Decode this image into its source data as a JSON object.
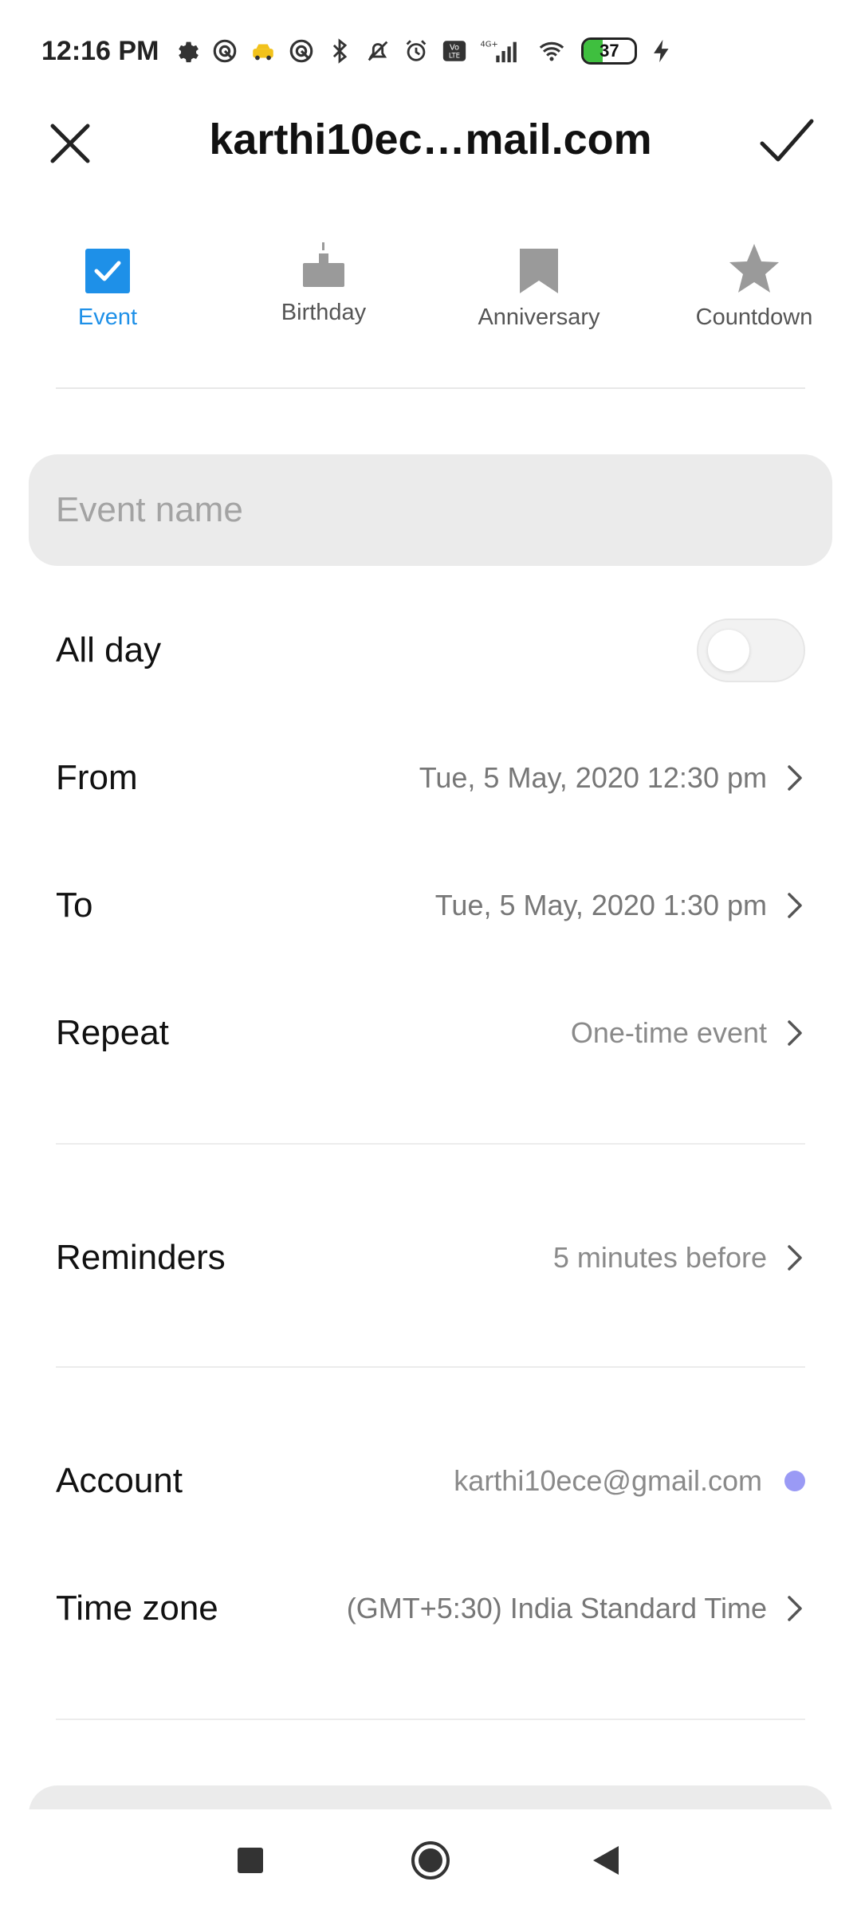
{
  "status_bar": {
    "time": "12:16 PM",
    "network": "4G+",
    "volte": "Vo LTE",
    "battery": "37",
    "battery_level": 0.37
  },
  "header": {
    "title": "karthi10ec…mail.com"
  },
  "tabs": [
    {
      "label": "Event",
      "icon": "checkbox-icon",
      "active": true
    },
    {
      "label": "Birthday",
      "icon": "cake-icon",
      "active": false
    },
    {
      "label": "Anniversary",
      "icon": "bookmark-icon",
      "active": false
    },
    {
      "label": "Countdown",
      "icon": "star-icon",
      "active": false
    }
  ],
  "event_name": {
    "placeholder": "Event name",
    "value": ""
  },
  "fields": {
    "all_day": {
      "label": "All day",
      "enabled": false
    },
    "from": {
      "label": "From",
      "value": "Tue, 5 May, 2020 12:30 pm"
    },
    "to": {
      "label": "To",
      "value": "Tue, 5 May, 2020 1:30 pm"
    },
    "repeat": {
      "label": "Repeat",
      "value": "One-time event"
    },
    "reminders": {
      "label": "Reminders",
      "value": "5 minutes before"
    },
    "account": {
      "label": "Account",
      "value": "karthi10ece@gmail.com",
      "color": "#9a9af5"
    },
    "time_zone": {
      "label": "Time zone",
      "value": "(GMT+5:30) India Standard Time"
    }
  },
  "colors": {
    "accent": "#1e90e8",
    "input_bg": "#ebebeb"
  }
}
